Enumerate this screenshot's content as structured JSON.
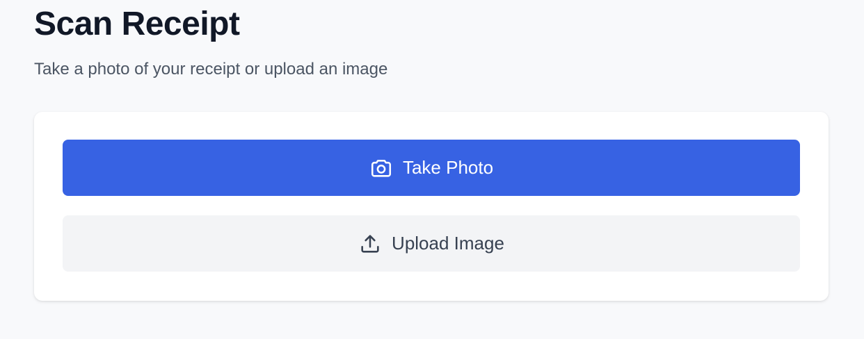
{
  "header": {
    "title": "Scan Receipt",
    "subtitle": "Take a photo of your receipt or upload an image"
  },
  "actions": {
    "take_photo": {
      "label": "Take Photo",
      "icon": "camera-icon",
      "color": "#3762e3"
    },
    "upload_image": {
      "label": "Upload Image",
      "icon": "upload-icon",
      "color": "#f3f4f6"
    }
  }
}
